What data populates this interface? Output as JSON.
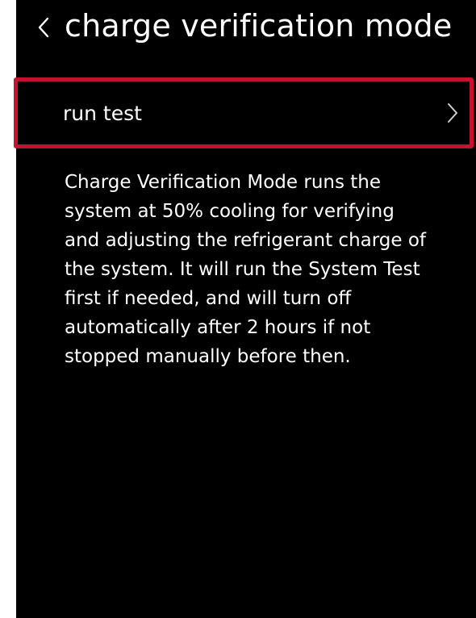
{
  "header": {
    "back_icon": "chevron-left-icon",
    "title": "charge verification mode"
  },
  "run_test": {
    "label": "run test",
    "icon": "chevron-right-icon",
    "highlight_color": "#c4122f"
  },
  "description": {
    "lines": [
      "Charge Verification Mode runs the",
      "system at 50% cooling for verifying",
      "and adjusting the refrigerant charge of",
      "the system. It will run the System Test",
      "first if needed, and will turn off",
      "automatically after 2 hours if not",
      "stopped manually before then."
    ]
  },
  "colors": {
    "background": "#000000",
    "text": "#ffffff",
    "accent": "#c4122f"
  }
}
